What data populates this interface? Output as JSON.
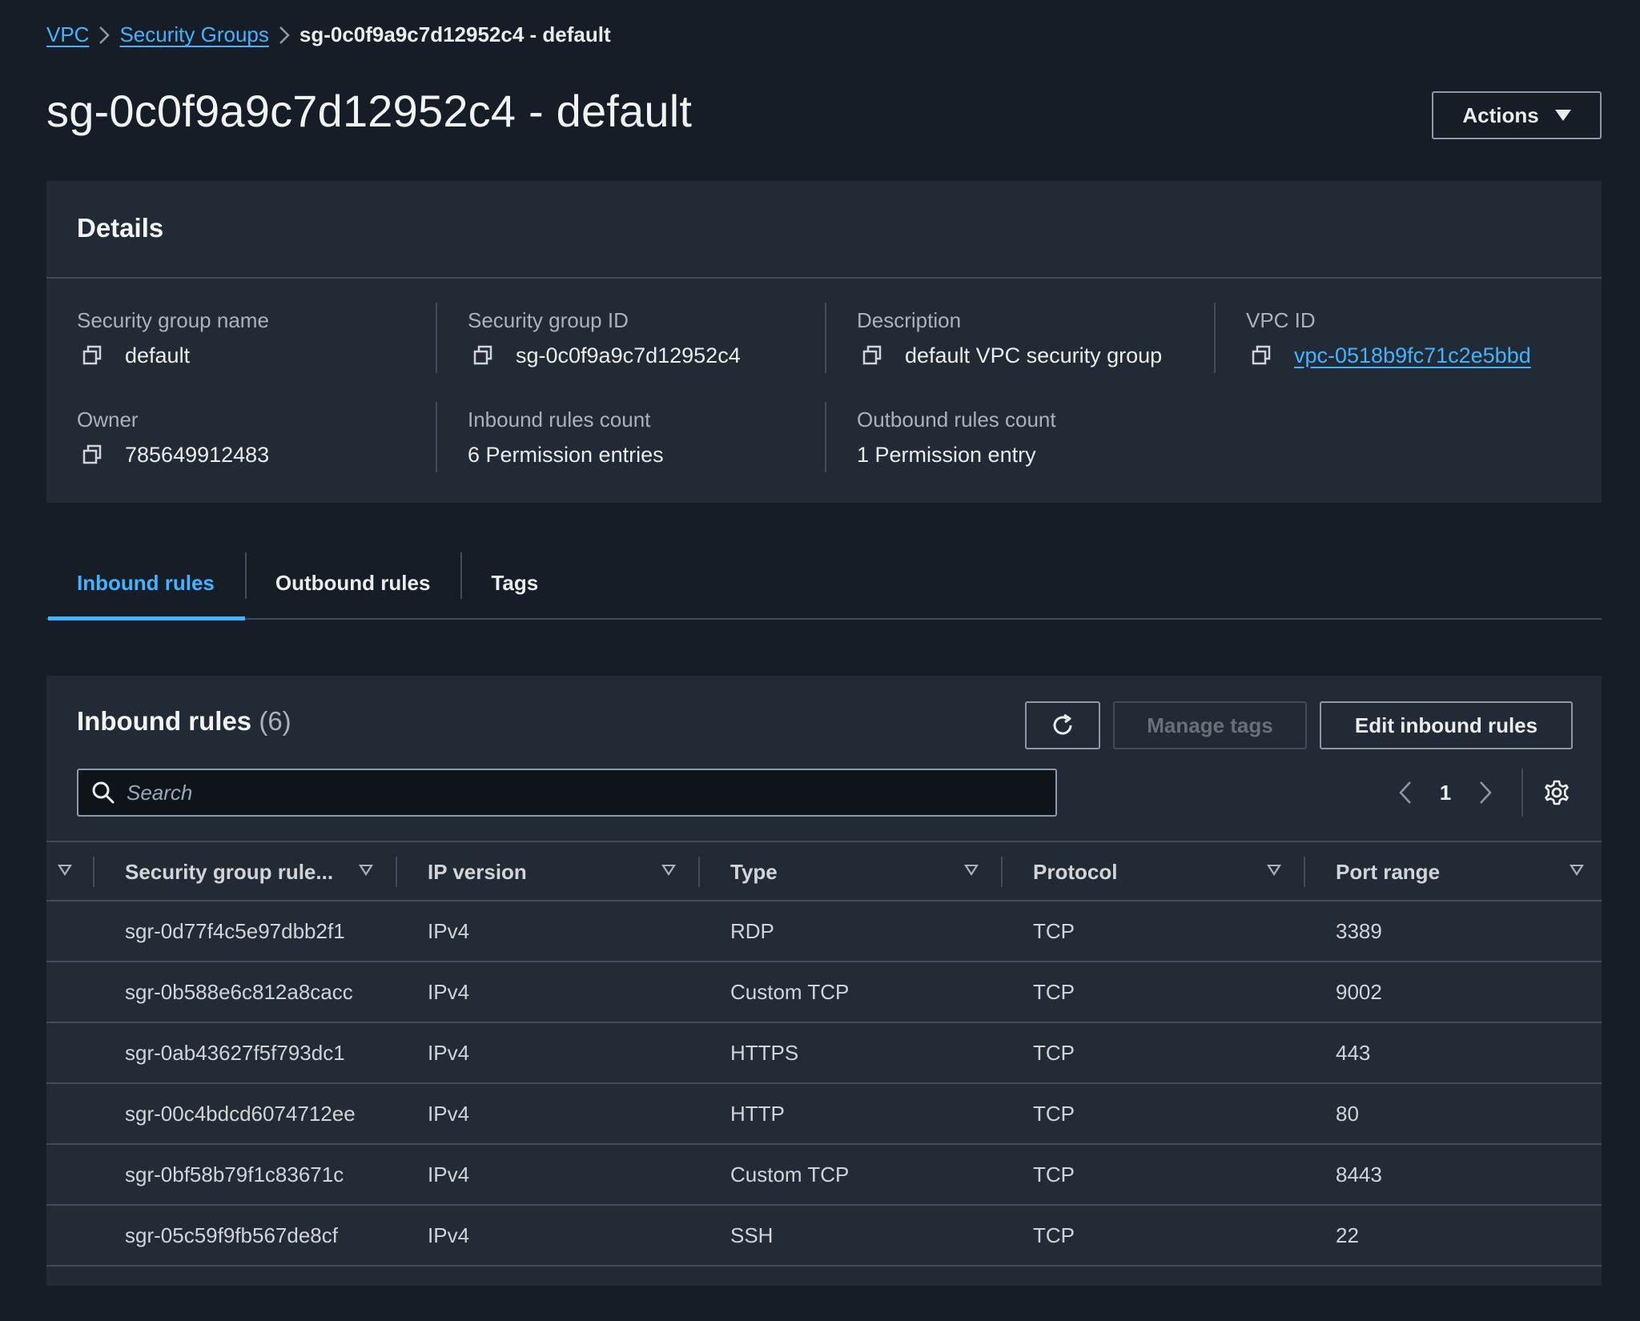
{
  "breadcrumb": {
    "vpc": "VPC",
    "security_groups": "Security Groups",
    "current": "sg-0c0f9a9c7d12952c4 - default"
  },
  "page_title": "sg-0c0f9a9c7d12952c4 - default",
  "actions_label": "Actions",
  "details": {
    "title": "Details",
    "fields": {
      "sg_name": {
        "label": "Security group name",
        "value": "default"
      },
      "sg_id": {
        "label": "Security group ID",
        "value": "sg-0c0f9a9c7d12952c4"
      },
      "description": {
        "label": "Description",
        "value": "default VPC security group"
      },
      "vpc_id": {
        "label": "VPC ID",
        "value": "vpc-0518b9fc71c2e5bbd"
      },
      "owner": {
        "label": "Owner",
        "value": "785649912483"
      },
      "inbound_count": {
        "label": "Inbound rules count",
        "value": "6 Permission entries"
      },
      "outbound_count": {
        "label": "Outbound rules count",
        "value": "1 Permission entry"
      }
    }
  },
  "tabs": [
    "Inbound rules",
    "Outbound rules",
    "Tags"
  ],
  "active_tab": "Inbound rules",
  "inbound_panel": {
    "title": "Inbound rules",
    "count": "(6)",
    "manage_tags_label": "Manage tags",
    "edit_label": "Edit inbound rules",
    "search_placeholder": "Search",
    "current_page": "1"
  },
  "table": {
    "columns": [
      "Security group rule...",
      "IP version",
      "Type",
      "Protocol",
      "Port range"
    ],
    "rows": [
      [
        "sgr-0d77f4c5e97dbb2f1",
        "IPv4",
        "RDP",
        "TCP",
        "3389"
      ],
      [
        "sgr-0b588e6c812a8cacc",
        "IPv4",
        "Custom TCP",
        "TCP",
        "9002"
      ],
      [
        "sgr-0ab43627f5f793dc1",
        "IPv4",
        "HTTPS",
        "TCP",
        "443"
      ],
      [
        "sgr-00c4bdcd6074712ee",
        "IPv4",
        "HTTP",
        "TCP",
        "80"
      ],
      [
        "sgr-0bf58b79f1c83671c",
        "IPv4",
        "Custom TCP",
        "TCP",
        "8443"
      ],
      [
        "sgr-05c59f9fb567de8cf",
        "IPv4",
        "SSH",
        "TCP",
        "22"
      ]
    ]
  },
  "colors": {
    "background": "#161d26",
    "panel": "#222a35",
    "accent_link": "#42b4ff",
    "border": "#414d5c"
  }
}
